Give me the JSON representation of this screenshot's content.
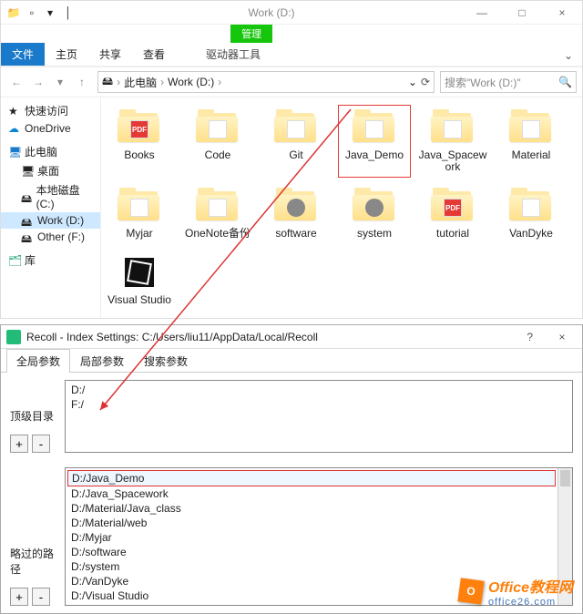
{
  "explorer": {
    "drive_title": "Work (D:)",
    "ribbon": {
      "file": "文件",
      "home": "主页",
      "share": "共享",
      "view": "查看",
      "context_header": "管理",
      "context_tab": "驱动器工具"
    },
    "crumbs": {
      "pc": "此电脑",
      "drive": "Work (D:)"
    },
    "search_placeholder": "搜索\"Work (D:)\"",
    "nav": {
      "quick": "快速访问",
      "onedrive": "OneDrive",
      "thispc": "此电脑",
      "desktop": "桌面",
      "localc": "本地磁盘 (C:)",
      "workd": "Work (D:)",
      "otherf": "Other (F:)",
      "libs": "库"
    },
    "folders": [
      {
        "label": "Books",
        "badge": "PDF"
      },
      {
        "label": "Code",
        "badge": ""
      },
      {
        "label": "Git",
        "badge": ""
      },
      {
        "label": "Java_Demo",
        "badge": "",
        "selected": true
      },
      {
        "label": "Java_Spacework",
        "badge": ""
      },
      {
        "label": "Material",
        "badge": ""
      },
      {
        "label": "Myjar",
        "badge": ""
      },
      {
        "label": "OneNote备份",
        "badge": ""
      },
      {
        "label": "software",
        "badge": "gear"
      },
      {
        "label": "system",
        "badge": "gear"
      },
      {
        "label": "tutorial",
        "badge": "PDF"
      },
      {
        "label": "VanDyke",
        "badge": ""
      },
      {
        "label": "Visual Studio",
        "badge": "vs"
      }
    ]
  },
  "recoll": {
    "title": "Recoll - Index Settings: C:/Users/liu11/AppData/Local/Recoll",
    "tabs": {
      "global": "全局参数",
      "local": "局部参数",
      "search": "搜索参数"
    },
    "top_label": "顶级目录",
    "top_dirs": [
      "D:/",
      "F:/"
    ],
    "skip_label": "略过的路径",
    "skip_paths": [
      "D:/Java_Demo",
      "D:/Java_Spacework",
      "D:/Material/Java_class",
      "D:/Material/web",
      "D:/Myjar",
      "D:/software",
      "D:/system",
      "D:/VanDyke",
      "D:/Visual Studio"
    ],
    "plus": "+",
    "minus": "-",
    "help": "?",
    "close": "×"
  },
  "watermark": {
    "logo": "O",
    "line1": "Office教程网",
    "line2": "office26.com"
  }
}
